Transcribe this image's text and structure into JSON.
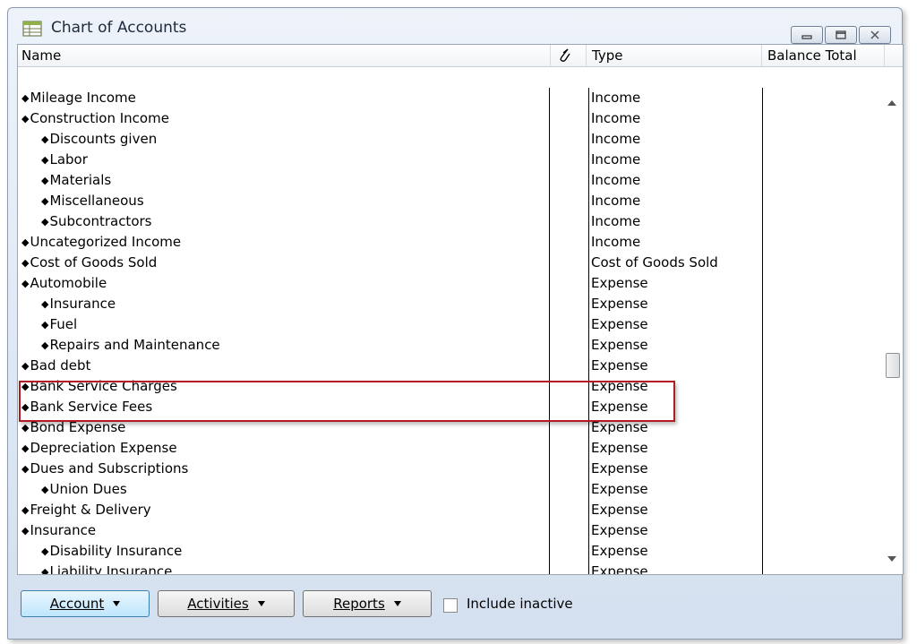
{
  "window": {
    "title": "Chart of Accounts",
    "buttons": [
      "minimize-icon",
      "restore-icon",
      "close-icon"
    ]
  },
  "columns": {
    "name": "Name",
    "attach_icon": "attach-icon",
    "type": "Type",
    "balance": "Balance Total"
  },
  "rows": [
    {
      "name": "Mileage Income",
      "type": "Income",
      "indent": 0
    },
    {
      "name": "Construction Income",
      "type": "Income",
      "indent": 0
    },
    {
      "name": "Discounts given",
      "type": "Income",
      "indent": 1
    },
    {
      "name": "Labor",
      "type": "Income",
      "indent": 1
    },
    {
      "name": "Materials",
      "type": "Income",
      "indent": 1
    },
    {
      "name": "Miscellaneous",
      "type": "Income",
      "indent": 1
    },
    {
      "name": "Subcontractors",
      "type": "Income",
      "indent": 1
    },
    {
      "name": "Uncategorized Income",
      "type": "Income",
      "indent": 0
    },
    {
      "name": "Cost of Goods Sold",
      "type": "Cost of Goods Sold",
      "indent": 0
    },
    {
      "name": "Automobile",
      "type": "Expense",
      "indent": 0
    },
    {
      "name": "Insurance",
      "type": "Expense",
      "indent": 1
    },
    {
      "name": "Fuel",
      "type": "Expense",
      "indent": 1
    },
    {
      "name": "Repairs and Maintenance",
      "type": "Expense",
      "indent": 1
    },
    {
      "name": "Bad debt",
      "type": "Expense",
      "indent": 0
    },
    {
      "name": "Bank Service Charges",
      "type": "Expense",
      "indent": 0
    },
    {
      "name": "Bank Service Fees",
      "type": "Expense",
      "indent": 0
    },
    {
      "name": "Bond Expense",
      "type": "Expense",
      "indent": 0
    },
    {
      "name": "Depreciation Expense",
      "type": "Expense",
      "indent": 0
    },
    {
      "name": "Dues and Subscriptions",
      "type": "Expense",
      "indent": 0
    },
    {
      "name": "Union Dues",
      "type": "Expense",
      "indent": 1
    },
    {
      "name": "Freight & Delivery",
      "type": "Expense",
      "indent": 0
    },
    {
      "name": "Insurance",
      "type": "Expense",
      "indent": 0
    },
    {
      "name": "Disability Insurance",
      "type": "Expense",
      "indent": 1
    },
    {
      "name": "Liability Insurance",
      "type": "Expense",
      "indent": 1
    }
  ],
  "highlight_color": "#b01c22",
  "footer": {
    "account": "Account",
    "activities": "Activities",
    "reports": "Reports",
    "include_inactive": "Include inactive"
  }
}
